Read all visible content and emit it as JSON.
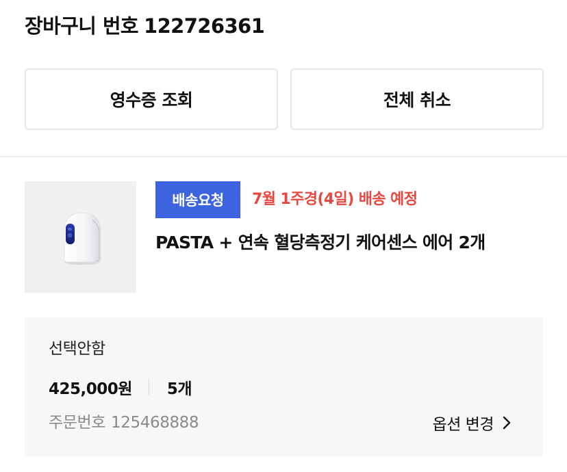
{
  "cart": {
    "label": "장바구니 번호",
    "number": "122726361"
  },
  "actions": {
    "receipt": "영수증 조회",
    "cancel_all": "전체 취소"
  },
  "item": {
    "status_badge": "배송요청",
    "delivery_eta": "7월 1주경(4일) 배송 예정",
    "name": "PASTA + 연속 혈당측정기 케어센스 에어 2개",
    "thumbnail_icon": "glucose-monitor-device",
    "option": {
      "label": "선택안함",
      "price": "425,000원",
      "quantity": "5개",
      "order_label": "주문번호",
      "order_number": "125468888",
      "change_label": "옵션 변경"
    }
  },
  "colors": {
    "badge_bg": "#3d63e0",
    "eta_text": "#e8483f",
    "option_bg": "#f7f7f7"
  }
}
